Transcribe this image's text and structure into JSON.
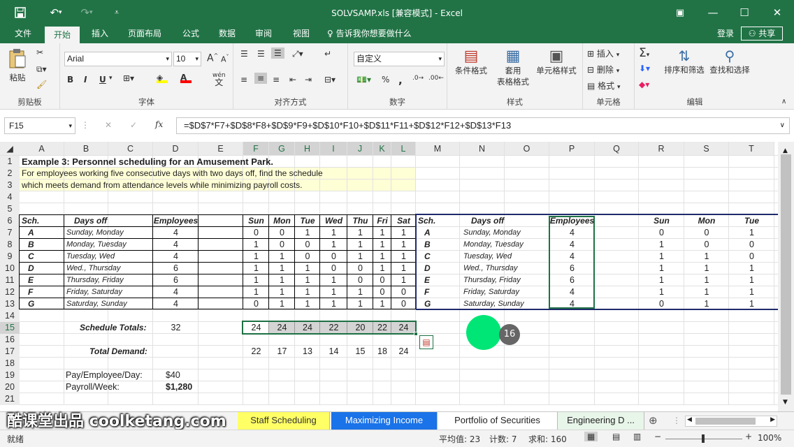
{
  "window": {
    "title": "SOLVSAMP.xls  [兼容模式] - Excel"
  },
  "ribbon_tabs": [
    {
      "label": "文件"
    },
    {
      "label": "开始"
    },
    {
      "label": "插入"
    },
    {
      "label": "页面布局"
    },
    {
      "label": "公式"
    },
    {
      "label": "数据"
    },
    {
      "label": "审阅"
    },
    {
      "label": "视图"
    }
  ],
  "tell_me": "告诉我你想要做什么",
  "account": {
    "login": "登录",
    "share": "共享"
  },
  "clipboard": {
    "paste": "粘贴",
    "group": "剪贴板"
  },
  "font": {
    "name": "Arial",
    "size": "10",
    "bold": "B",
    "italic": "I",
    "underline": "U",
    "group": "字体",
    "wen": "wén",
    "wen_char": "文",
    "grow": "A",
    "shrink": "A"
  },
  "alignment": {
    "group": "对齐方式"
  },
  "number": {
    "format": "自定义",
    "group": "数字",
    "percent": "%",
    "comma": ","
  },
  "styles": {
    "cond": "条件格式",
    "table": "套用",
    "table2": "表格格式",
    "cell": "单元格样式",
    "group": "样式"
  },
  "cells": {
    "insert": "插入",
    "delete": "删除",
    "format": "格式",
    "group": "单元格"
  },
  "editing": {
    "sort": "排序和筛选",
    "find": "查找和选择",
    "group": "编辑",
    "sigma": "Σ"
  },
  "namebox": "F15",
  "formula": "=$D$7*F7+$D$8*F8+$D$9*F9+$D$10*F10+$D$11*F11+$D$12*F12+$D$13*F13",
  "fx": "fx",
  "columns": [
    "A",
    "B",
    "C",
    "D",
    "E",
    "F",
    "G",
    "H",
    "I",
    "J",
    "K",
    "L",
    "M",
    "N",
    "O",
    "P",
    "Q",
    "R",
    "S",
    "T"
  ],
  "rows": [
    "1",
    "2",
    "3",
    "4",
    "5",
    "6",
    "7",
    "8",
    "9",
    "10",
    "11",
    "12",
    "13",
    "14",
    "15",
    "16",
    "17",
    "18",
    "19",
    "20",
    "21"
  ],
  "sheet": {
    "title": "Example 3:  Personnel scheduling for an Amusement Park.",
    "line2": "For employees working five consecutive days with two days off, find the schedule",
    "line3": "which meets demand from attendance levels while minimizing payroll costs.",
    "hdr_sch": "Sch.",
    "hdr_days": "Days off",
    "hdr_emp": "Employees",
    "days": [
      "Sun",
      "Mon",
      "Tue",
      "Wed",
      "Thu",
      "Fri",
      "Sat"
    ],
    "right_days": [
      "Sun",
      "Mon",
      "Tue"
    ],
    "schedules": [
      {
        "sch": "A",
        "off": "Sunday, Monday",
        "emp": "4",
        "vals": [
          "0",
          "0",
          "1",
          "1",
          "1",
          "1",
          "1"
        ]
      },
      {
        "sch": "B",
        "off": "Monday, Tuesday",
        "emp": "4",
        "vals": [
          "1",
          "0",
          "0",
          "1",
          "1",
          "1",
          "1"
        ]
      },
      {
        "sch": "C",
        "off": "Tuesday, Wed",
        "emp": "4",
        "vals": [
          "1",
          "1",
          "0",
          "0",
          "1",
          "1",
          "1"
        ]
      },
      {
        "sch": "D",
        "off": "Wed., Thursday",
        "emp": "6",
        "vals": [
          "1",
          "1",
          "1",
          "0",
          "0",
          "1",
          "1"
        ]
      },
      {
        "sch": "E",
        "off": "Thursday, Friday",
        "emp": "6",
        "vals": [
          "1",
          "1",
          "1",
          "1",
          "0",
          "0",
          "1"
        ]
      },
      {
        "sch": "F",
        "off": "Friday, Saturday",
        "emp": "4",
        "vals": [
          "1",
          "1",
          "1",
          "1",
          "1",
          "0",
          "0"
        ]
      },
      {
        "sch": "G",
        "off": "Saturday, Sunday",
        "emp": "4",
        "vals": [
          "0",
          "1",
          "1",
          "1",
          "1",
          "1",
          "0"
        ]
      }
    ],
    "totals_label": "Schedule Totals:",
    "totals_emp": "32",
    "totals": [
      "24",
      "24",
      "24",
      "22",
      "20",
      "22",
      "24"
    ],
    "demand_label": "Total Demand:",
    "demand": [
      "22",
      "17",
      "13",
      "14",
      "15",
      "18",
      "24"
    ],
    "pay_label": "Pay/Employee/Day:",
    "pay_value": "$40",
    "payroll_label": "Payroll/Week:",
    "payroll_value": "$1,280"
  },
  "marker": "16",
  "sheet_tabs": [
    {
      "label": "Staff Scheduling"
    },
    {
      "label": "Maximizing Income"
    },
    {
      "label": "Portfolio of Securities"
    },
    {
      "label": "Engineering D ..."
    }
  ],
  "watermark": "酷课堂出品 coolketang.com",
  "status": {
    "ready": "就绪",
    "average": "平均值: 23",
    "count": "计数: 7",
    "sum": "求和: 160",
    "zoom": "100%"
  },
  "colors": {
    "excel_green": "#217346",
    "selection": "#1e7145",
    "tab_blue": "#1a73e8",
    "tab_yellow": "#ffff66",
    "marker_green": "#00e676"
  }
}
